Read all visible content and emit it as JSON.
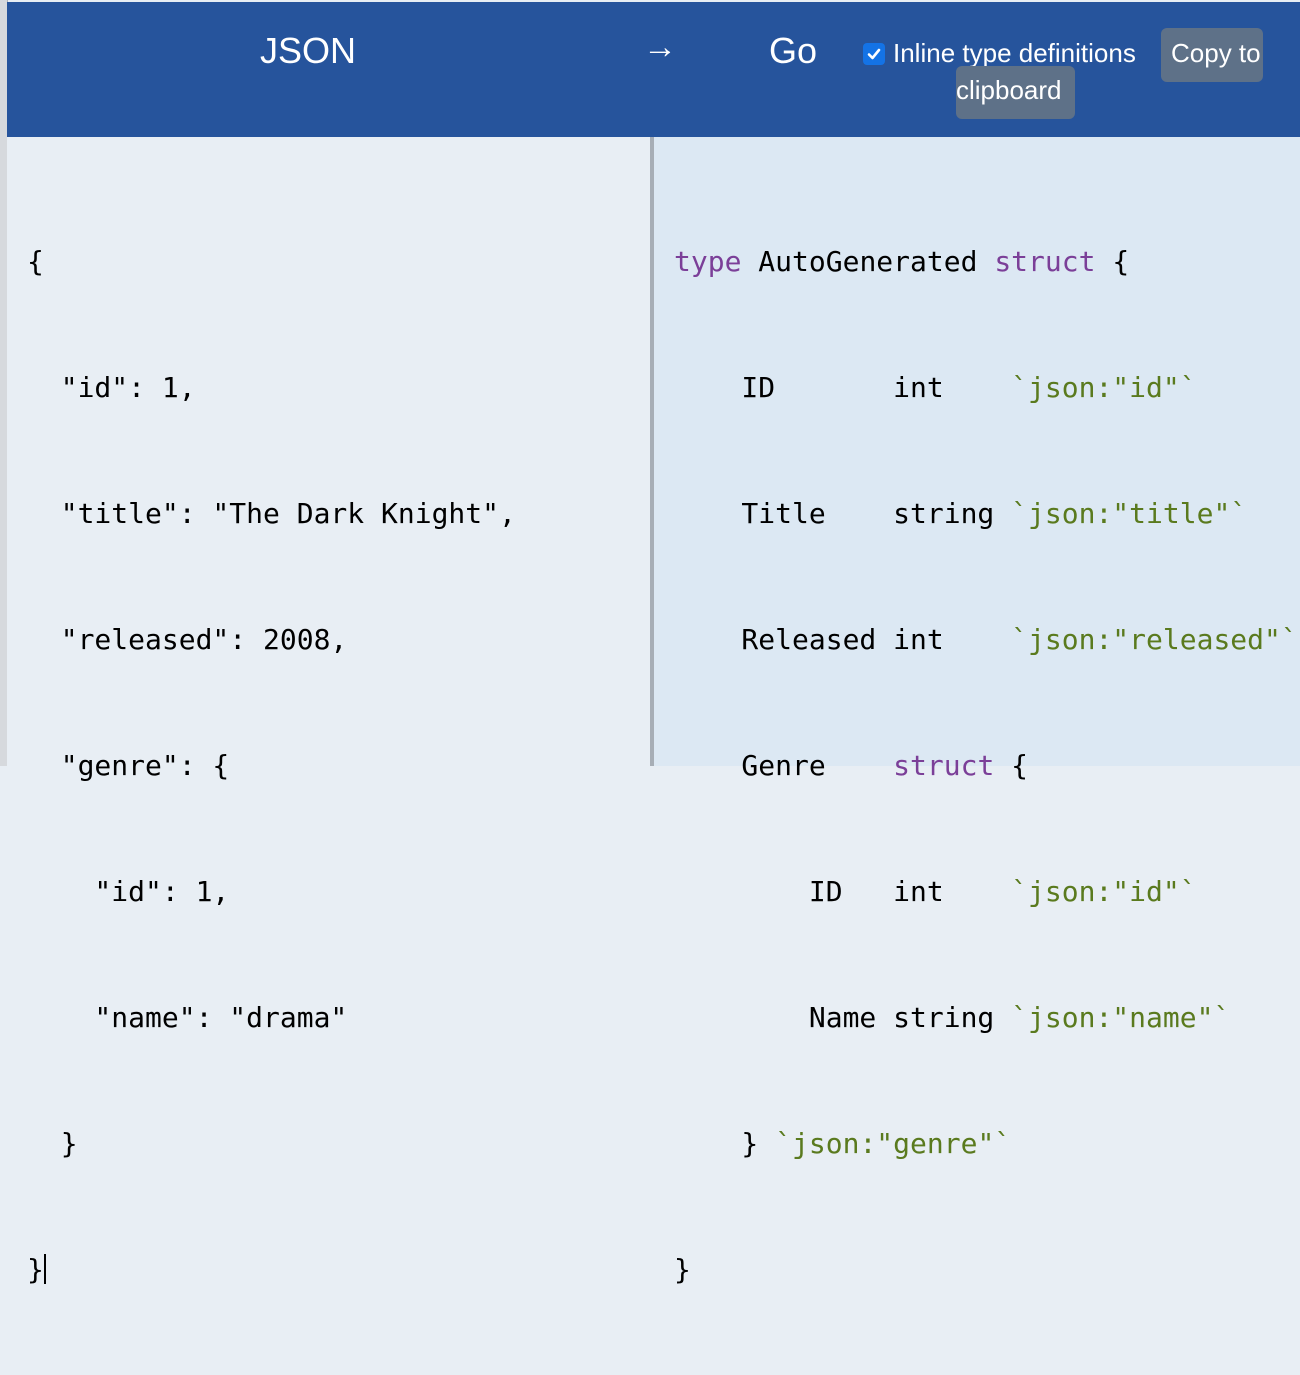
{
  "header": {
    "left_title": "JSON",
    "arrow": "→",
    "right_title": "Go",
    "inline_option": {
      "label": "Inline type definitions",
      "checked": true
    },
    "copy_button": {
      "line1": "Copy to",
      "line2": "clipboard"
    }
  },
  "json_input": {
    "lines": [
      "{",
      "  \"id\": 1,",
      "  \"title\": \"The Dark Knight\",",
      "  \"released\": 2008,",
      "  \"genre\": {",
      "    \"id\": 1,",
      "    \"name\": \"drama\"",
      "  }",
      "}"
    ]
  },
  "go_output": {
    "line0": {
      "kw_type": "type",
      "name": " AutoGenerated ",
      "kw_struct": "struct",
      "rest": " {"
    },
    "line1": {
      "field": "    ID       int    ",
      "tag": "`json:\"id\"`"
    },
    "line2": {
      "field": "    Title    string ",
      "tag": "`json:\"title\"`"
    },
    "line3": {
      "field": "    Released int    ",
      "tag": "`json:\"released\"`"
    },
    "line4": {
      "field": "    Genre    ",
      "kw_struct": "struct",
      "rest": " {"
    },
    "line5": {
      "field": "        ID   int    ",
      "tag": "`json:\"id\"`"
    },
    "line6": {
      "field": "        Name string ",
      "tag": "`json:\"name\"`"
    },
    "line7": {
      "field": "    } ",
      "tag": "`json:\"genre\"`"
    },
    "line8": {
      "field": "}"
    }
  },
  "colors": {
    "header_bg": "#26549c",
    "keyword": "#7b3f98",
    "tag": "#5a7a1e",
    "checkbox": "#1473e6",
    "button_bg": "#5e7188"
  }
}
